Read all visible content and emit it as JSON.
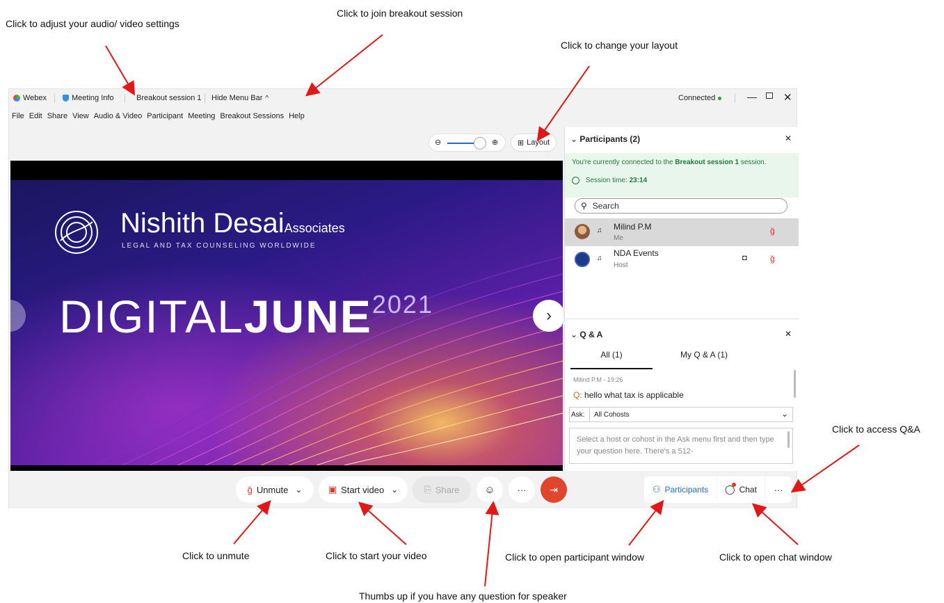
{
  "annotations": {
    "audio_video": "Click to adjust your audio/ video settings",
    "breakout": "Click to join breakout session",
    "layout": "Click to change your layout",
    "qa": "Click to access Q&A",
    "unmute": "Click to unmute",
    "start_video": "Click to start your video",
    "participant_window": "Click to open participant window",
    "chat_window": "Click to open chat window",
    "thumbs_up": "Thumbs up if you have any question for speaker"
  },
  "titlebar": {
    "app": "Webex",
    "meeting_info": "Meeting Info",
    "breakout": "Breakout session 1",
    "hide_menu": "Hide Menu Bar",
    "status": "Connected"
  },
  "menubar": [
    "File",
    "Edit",
    "Share",
    "View",
    "Audio & Video",
    "Participant",
    "Meeting",
    "Breakout Sessions",
    "Help"
  ],
  "layout_label": "Layout",
  "slide": {
    "brand": "Nishith Desai",
    "brand_suffix": "Associates",
    "tagline": "LEGAL AND TAX COUNSELING WORLDWIDE",
    "title_light": "DIGITAL",
    "title_bold": "JUNE",
    "year": "2021"
  },
  "participants": {
    "header": "Participants (2)",
    "banner_pre": "You're currently connected to the",
    "banner_bold": "Breakout session 1",
    "banner_post": "session.",
    "session_label": "Session time:",
    "session_time": "23:14",
    "search_placeholder": "Search",
    "list": [
      {
        "name": "Milind P.M",
        "role": "Me"
      },
      {
        "name": "NDA Events",
        "role": "Host"
      }
    ]
  },
  "qa": {
    "header": "Q & A",
    "tab_all": "All (1)",
    "tab_mine": "My Q & A (1)",
    "meta": "Milind P.M - 19:26",
    "q_prefix": "Q:",
    "question": "hello what tax is applicable",
    "ask_label": "Ask:",
    "ask_value": "All Cohosts",
    "input_placeholder": "Select a host or cohost in the Ask menu first and then type your question here. There's a 512-"
  },
  "toolbar": {
    "unmute": "Unmute",
    "start_video": "Start video",
    "share": "Share",
    "more": "···",
    "participants": "Participants",
    "chat": "Chat"
  },
  "colors": {
    "accent": "#1a6fd1",
    "green": "#1c7a3a",
    "mute_red": "#e0342c",
    "leave_red": "#e0452e"
  }
}
